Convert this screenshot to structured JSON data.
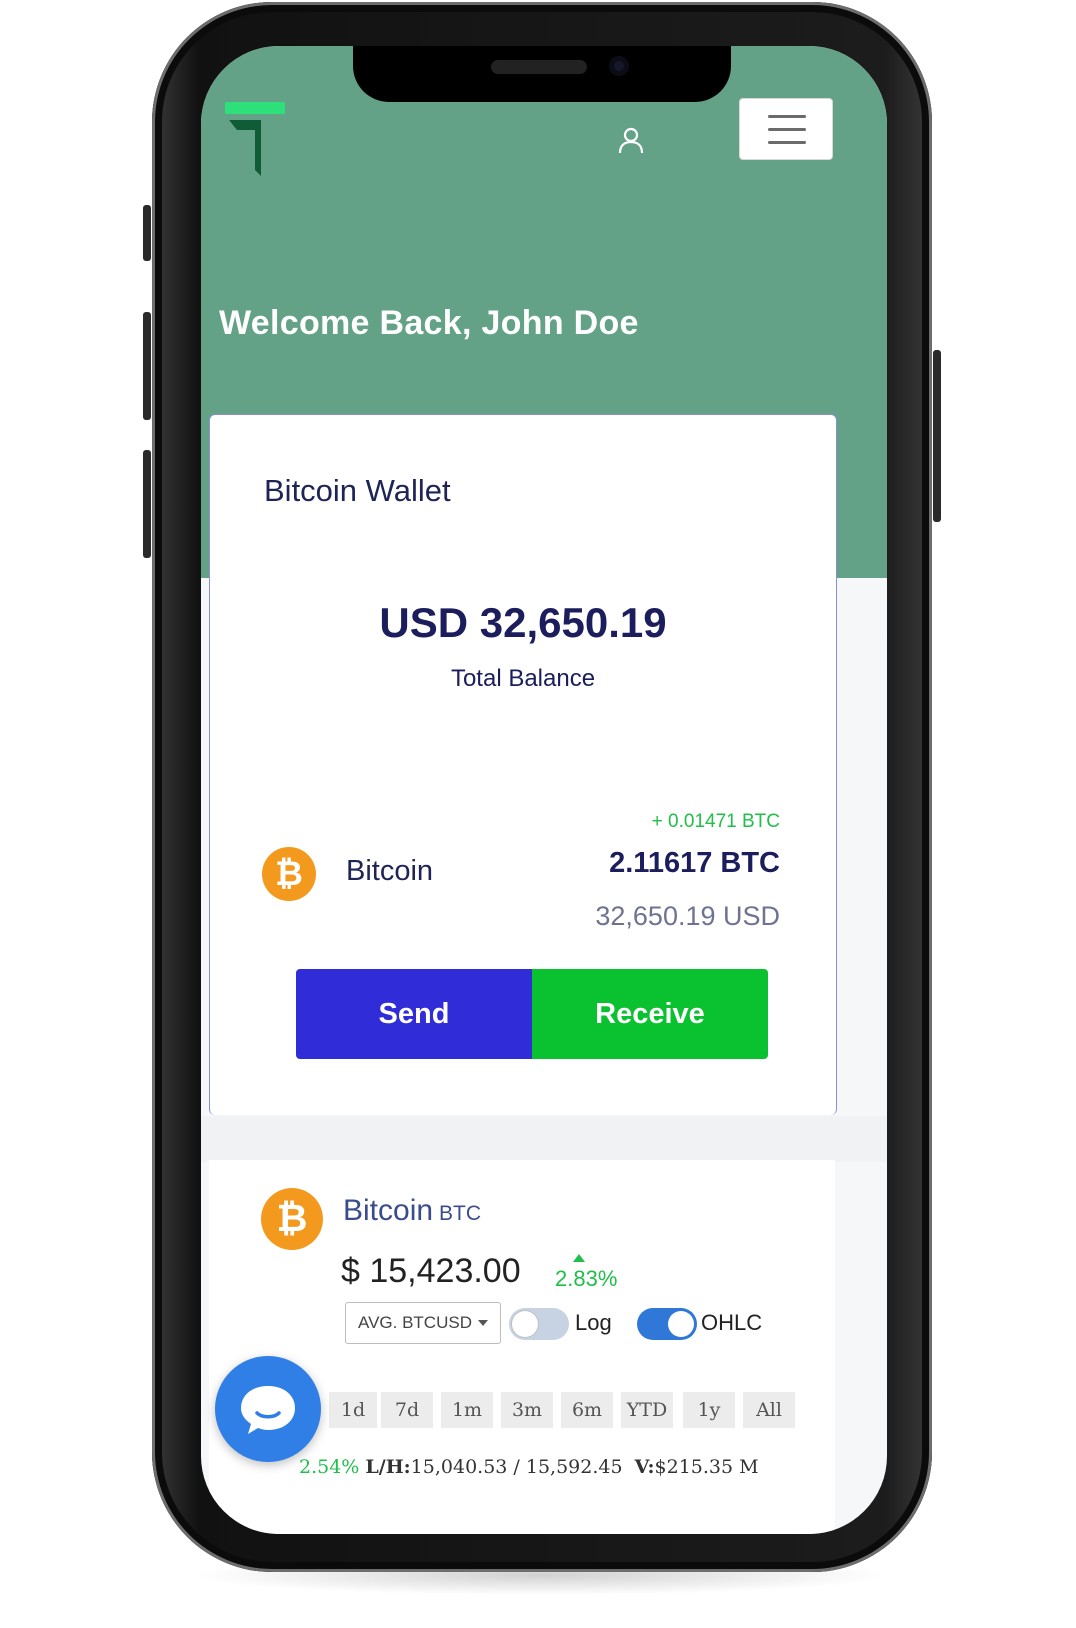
{
  "header": {
    "welcome": "Welcome Back, John Doe",
    "colors": {
      "header_bg": "#63a287",
      "logo_accent": "#2ee07a",
      "logo_dark": "#0f5c36"
    }
  },
  "icons": {
    "profile": "user-icon",
    "menu": "hamburger-menu-icon",
    "chat": "chat-bubble-icon",
    "coin": "bitcoin-icon"
  },
  "wallet": {
    "title": "Bitcoin Wallet",
    "balance": "USD 32,650.19",
    "balance_label": "Total Balance",
    "asset": {
      "name": "Bitcoin",
      "coin_symbol": "₿",
      "delta": "+ 0.01471 BTC",
      "amount": "2.11617 BTC",
      "usd_value": "32,650.19 USD"
    },
    "buttons": {
      "send": "Send",
      "receive": "Receive"
    },
    "colors": {
      "send": "#2f2cd8",
      "receive": "#0ac22f",
      "text": "#1b1d5c"
    }
  },
  "market": {
    "name": "Bitcoin",
    "ticker": "BTC",
    "price": "$ 15,423.00",
    "change": "2.83%",
    "select_value": "AVG. BTCUSD",
    "toggles": [
      {
        "label": "Log",
        "on": false
      },
      {
        "label": "OHLC",
        "on": true
      }
    ],
    "ranges": [
      "1d",
      "7d",
      "1m",
      "3m",
      "6m",
      "YTD",
      "1y",
      "All"
    ],
    "stats": {
      "pct": "2.54%",
      "low_high_label": "L/H:",
      "low_high": "15,040.53 / 15,592.45",
      "volume_label": "V:",
      "volume": "$215.35 M"
    }
  }
}
